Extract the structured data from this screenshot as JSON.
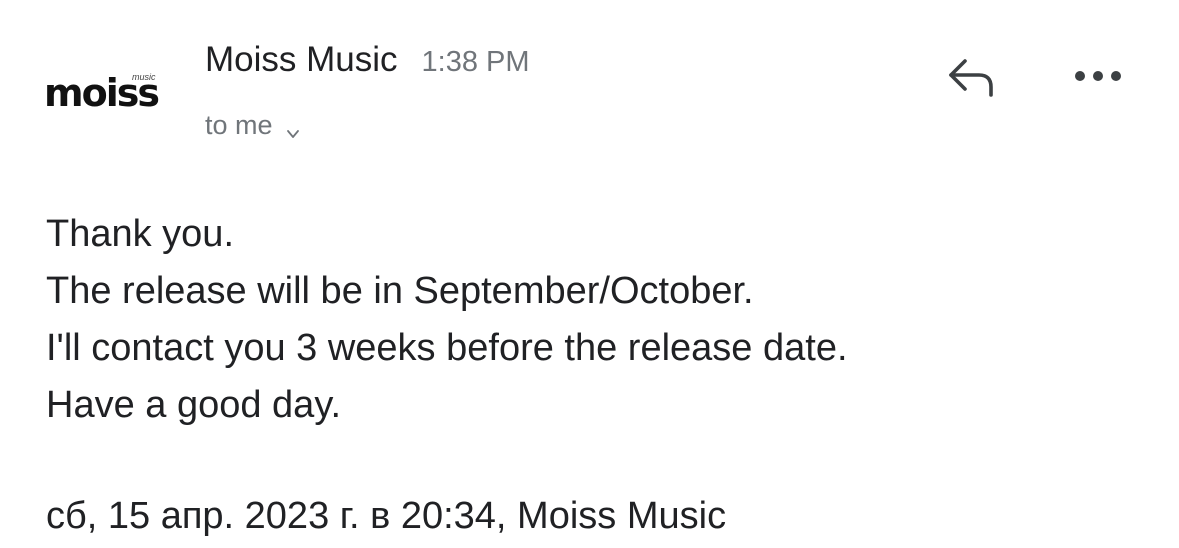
{
  "sender": {
    "avatar_logo_text": "moiss",
    "avatar_logo_sub": "music",
    "name": "Moiss Music",
    "time": "1:38 PM"
  },
  "recipient": {
    "label": "to me"
  },
  "actions": {
    "reply_icon": "reply-icon",
    "more_icon": "more-horizontal-icon"
  },
  "message": {
    "lines": [
      "Thank you.",
      "The release will be in September/October.",
      "I'll contact you 3 weeks before the release date.",
      "Have a good day."
    ]
  },
  "quoted_header": "сб, 15 апр. 2023 г. в 20:34, Moiss Music"
}
